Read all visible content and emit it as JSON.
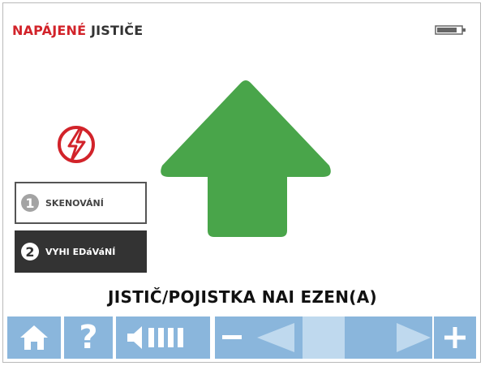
{
  "header": {
    "title_highlight": "NAPÁJENÉ",
    "title_rest": "JISTIČE",
    "battery_icon": "battery-icon"
  },
  "hazard_icon": "high-voltage-icon",
  "direction_icon": "up-arrow-icon",
  "modes": [
    {
      "number": "1",
      "label": "SKENOVÁNÍ",
      "active": false
    },
    {
      "number": "2",
      "label": "VYHI EDáVáNÍ",
      "active": true
    }
  ],
  "status_text": "JISTIČ/POJISTKA NAI EZEN(A)",
  "toolbar": {
    "home_icon": "home-icon",
    "help_label": "?",
    "volume_icon": "volume-icon",
    "minus_icon": "minus-icon",
    "left_icon": "left-arrow-icon",
    "right_icon": "right-arrow-icon",
    "plus_icon": "plus-icon"
  },
  "colors": {
    "accent_red": "#d2232a",
    "arrow_green": "#49a54a",
    "toolbar_blue": "#8ab6dc"
  }
}
